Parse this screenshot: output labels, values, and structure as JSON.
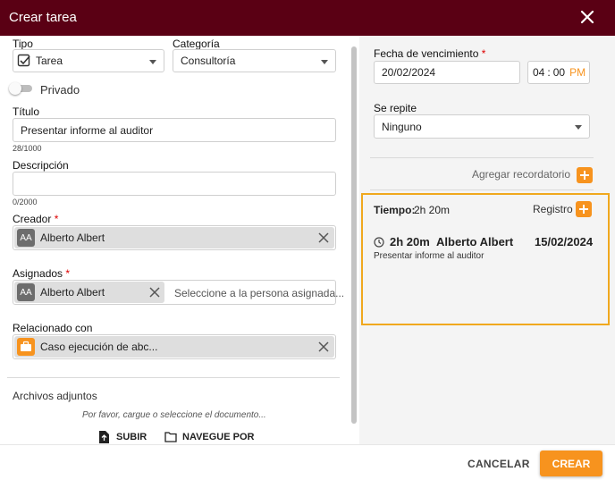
{
  "dialog": {
    "title": "Crear tarea"
  },
  "form": {
    "tipo": {
      "label": "Tipo",
      "value": "Tarea"
    },
    "categoria": {
      "label": "Categoría",
      "value": "Consultoría"
    },
    "privado": {
      "label": "Privado",
      "on": false
    },
    "titulo": {
      "label": "Título",
      "value": "Presentar informe al auditor",
      "counter": "28/1000"
    },
    "descripcion": {
      "label": "Descripción",
      "value": "",
      "counter": "0/2000"
    },
    "creador": {
      "label": "Creador",
      "required_mark": "*",
      "initials": "AA",
      "name": "Alberto Albert"
    },
    "asignados": {
      "label": "Asignados",
      "required_mark": "*",
      "initials": "AA",
      "name": "Alberto Albert",
      "placeholder": "Seleccione a la persona asignada..."
    },
    "relacionado": {
      "label": "Relacionado con",
      "name": "Caso ejecución de abc..."
    },
    "archivos": {
      "label": "Archivos adjuntos",
      "hint": "Por favor, cargue o seleccione el documento...",
      "upload_label": "SUBIR",
      "browse_label": "NAVEGUE POR"
    }
  },
  "right": {
    "vencimiento": {
      "label": "Fecha de vencimiento",
      "required_mark": "*",
      "date": "20/02/2024",
      "hour": "04",
      "separator": ":",
      "minute": "00",
      "ampm": "PM"
    },
    "repite": {
      "label": "Se repite",
      "value": "Ninguno"
    },
    "recordatorio": {
      "label": "Agregar recordatorio"
    },
    "tiempo": {
      "label": "Tiempo:",
      "total": "2h 20m",
      "registro_label": "Registro",
      "entries": [
        {
          "duration": "2h 20m",
          "person": "Alberto Albert",
          "date": "15/02/2024",
          "note": "Presentar informe al auditor"
        }
      ]
    }
  },
  "footer": {
    "cancel_label": "CANCELAR",
    "create_label": "CREAR"
  },
  "colors": {
    "header": "#5a0014",
    "accent": "#f7931e",
    "highlight_border": "#f0a81e"
  },
  "icons": [
    "close-icon",
    "checkbox-icon",
    "chevron-down-icon",
    "clear-icon",
    "briefcase-icon",
    "plus-icon",
    "clock-icon",
    "file-upload-icon",
    "folder-icon"
  ]
}
